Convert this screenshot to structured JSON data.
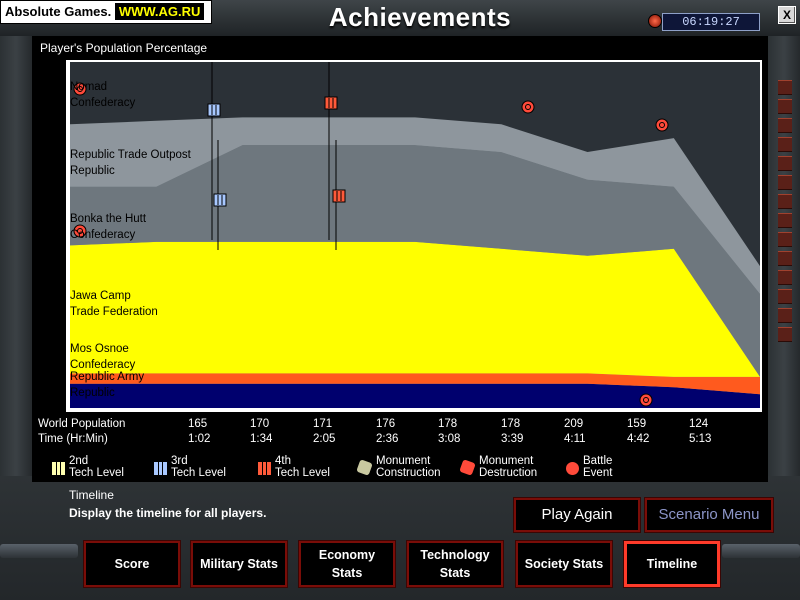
{
  "site": {
    "name": "Absolute Games.",
    "url": "WWW.AG.RU"
  },
  "header": {
    "title": "Achievements",
    "clock": "06:19:27",
    "close_label": "X"
  },
  "chart_caption": "Player's Population Percentage",
  "players": [
    {
      "line1": "Nomad",
      "line2": "Confederacy",
      "color": "#2b3137"
    },
    {
      "line1": "Republic Trade Outpost",
      "line2": "Republic",
      "color": "#8e969d"
    },
    {
      "line1": "Bonka the Hutt",
      "line2": "Confederacy",
      "color": "#6e777e"
    },
    {
      "line1": "Jawa Camp",
      "line2": "Trade Federation",
      "color": "#ffff00"
    },
    {
      "line1": "Mos Osnoe",
      "line2": "Confederacy",
      "color": "#ff5a1e"
    },
    {
      "line1": "Republic Army",
      "line2": "Republic",
      "color": "#00006e"
    }
  ],
  "stats": {
    "population_label": "World Population",
    "time_label": "Time (Hr:Min)",
    "population": [
      "165",
      "170",
      "171",
      "176",
      "178",
      "178",
      "209",
      "159",
      "124"
    ],
    "time": [
      "1:02",
      "1:34",
      "2:05",
      "2:36",
      "3:08",
      "3:39",
      "4:11",
      "4:42",
      "5:13"
    ]
  },
  "legend": [
    {
      "line1": "2nd",
      "line2": "Tech Level",
      "icon": "tech-level-2-icon",
      "color": "#ffffb0"
    },
    {
      "line1": "3rd",
      "line2": "Tech Level",
      "icon": "tech-level-3-icon",
      "color": "#a8c8ff"
    },
    {
      "line1": "4th",
      "line2": "Tech Level",
      "icon": "tech-level-4-icon",
      "color": "#ff5a3a"
    },
    {
      "line1": "Monument",
      "line2": "Construction",
      "icon": "monument-construction-icon",
      "color": "#c8c8a0"
    },
    {
      "line1": "Monument",
      "line2": "Destruction",
      "icon": "monument-destruction-icon",
      "color": "#ff4a3a"
    },
    {
      "line1": "Battle",
      "line2": "Event",
      "icon": "battle-event-icon",
      "color": "#ff4a3a"
    }
  ],
  "timeline": {
    "title": "Timeline",
    "description": "Display the timeline for all players."
  },
  "actions": {
    "play_again": "Play Again",
    "scenario_menu": "Scenario Menu"
  },
  "nav": [
    {
      "line1": "Score",
      "line2": ""
    },
    {
      "line1": "Military Stats",
      "line2": ""
    },
    {
      "line1": "Economy",
      "line2": "Stats"
    },
    {
      "line1": "Technology",
      "line2": "Stats"
    },
    {
      "line1": "Society Stats",
      "line2": ""
    },
    {
      "line1": "Timeline",
      "line2": "",
      "active": true
    }
  ],
  "chart_data": {
    "type": "area",
    "title": "Player's Population Percentage",
    "x": [
      "1:02",
      "1:34",
      "2:05",
      "2:36",
      "3:08",
      "3:39",
      "4:11",
      "4:42",
      "5:13"
    ],
    "xlabel": "Time (Hr:Min)",
    "stacked_percent": true,
    "series": [
      {
        "name": "Republic Army / Republic",
        "color": "#00006e",
        "values": [
          7,
          7,
          7,
          7,
          7,
          7,
          7,
          6,
          4
        ]
      },
      {
        "name": "Mos Osnoe / Confederacy",
        "color": "#ff5a1e",
        "values": [
          3,
          3,
          3,
          3,
          3,
          3,
          3,
          3,
          5
        ]
      },
      {
        "name": "Jawa Camp / Trade Federation",
        "color": "#ffff00",
        "values": [
          37,
          38,
          38,
          38,
          38,
          36,
          34,
          37,
          0
        ]
      },
      {
        "name": "Bonka the Hutt / Confederacy",
        "color": "#6e777e",
        "values": [
          17,
          16,
          28,
          28,
          28,
          28,
          22,
          18,
          24
        ]
      },
      {
        "name": "Republic Trade Outpost / Republic",
        "color": "#8e969d",
        "values": [
          18,
          19,
          8,
          8,
          8,
          8,
          8,
          14,
          8
        ]
      },
      {
        "name": "Nomad / Confederacy",
        "color": "#2b3137",
        "values": [
          18,
          17,
          16,
          16,
          16,
          18,
          26,
          22,
          59
        ]
      }
    ]
  }
}
